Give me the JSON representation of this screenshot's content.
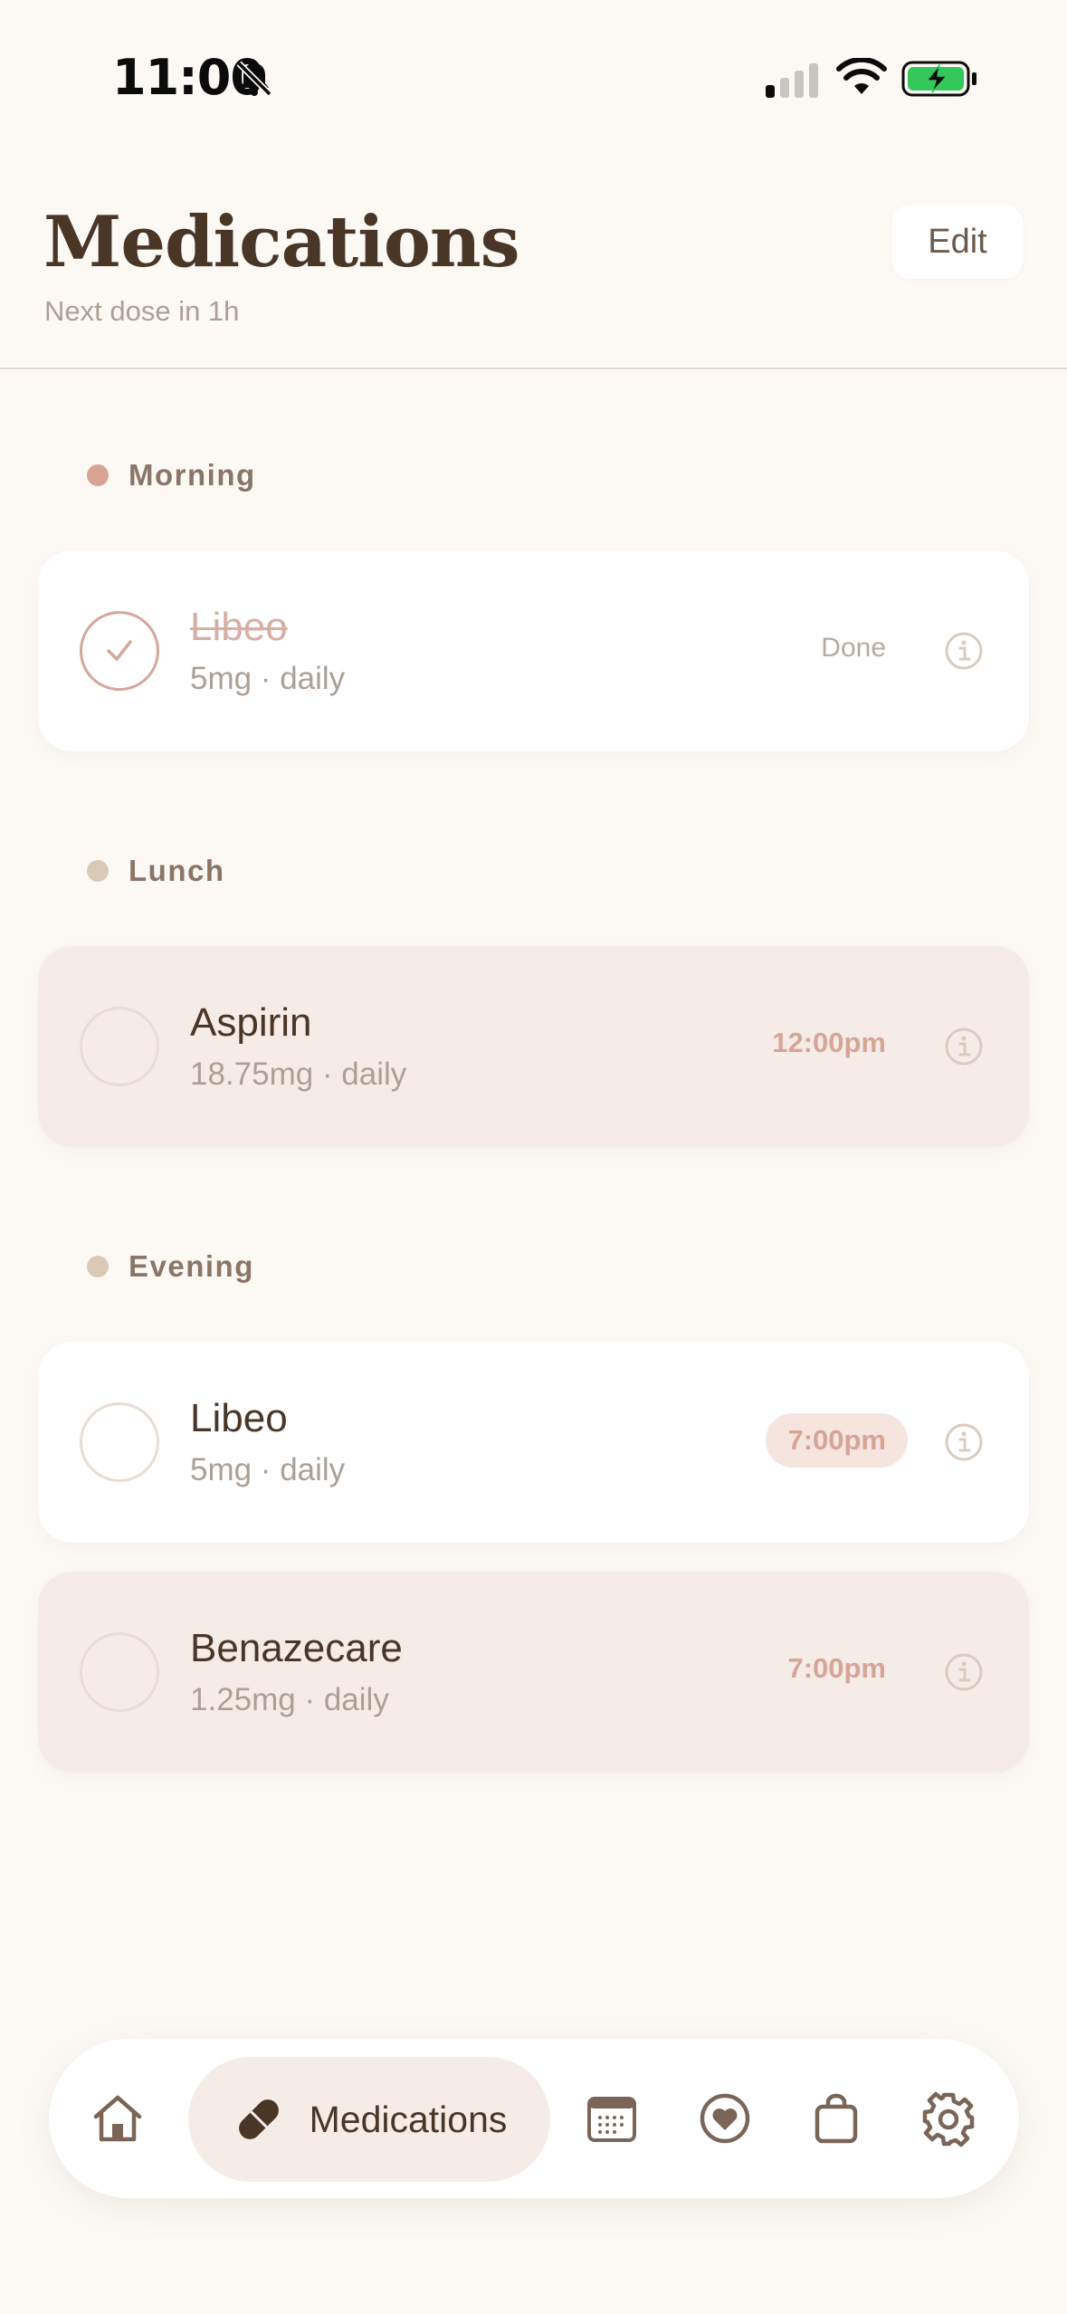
{
  "status_bar": {
    "time": "11:00"
  },
  "header": {
    "title": "Medications",
    "subtitle": "Next dose in 1h",
    "edit_label": "Edit"
  },
  "sections": [
    {
      "label": "Morning",
      "dot_color": "#d9a394"
    },
    {
      "label": "Lunch",
      "dot_color": "#dbc9b8"
    },
    {
      "label": "Evening",
      "dot_color": "#dbc9b8"
    }
  ],
  "medications": [
    {
      "name": "Libeo",
      "detail": "5mg · daily",
      "status": "Done",
      "completed": true
    },
    {
      "name": "Aspirin",
      "detail": "18.75mg · daily",
      "time": "12:00pm",
      "completed": false
    },
    {
      "name": "Libeo",
      "detail": "5mg · daily",
      "time": "7:00pm",
      "completed": false,
      "highlighted": true
    },
    {
      "name": "Benazecare",
      "detail": "1.25mg · daily",
      "time": "7:00pm",
      "completed": false
    }
  ],
  "bottom_nav": {
    "active_label": "Medications",
    "items": [
      "home-icon",
      "pill-icon",
      "calendar-icon",
      "heart-icon",
      "bag-icon",
      "gear-icon"
    ]
  },
  "colors": {
    "background": "#fcf9f5",
    "accent": "#d6a597",
    "card_pink": "#f6ece7",
    "text_dark": "#4a3626",
    "text_muted": "#ad9f93"
  }
}
